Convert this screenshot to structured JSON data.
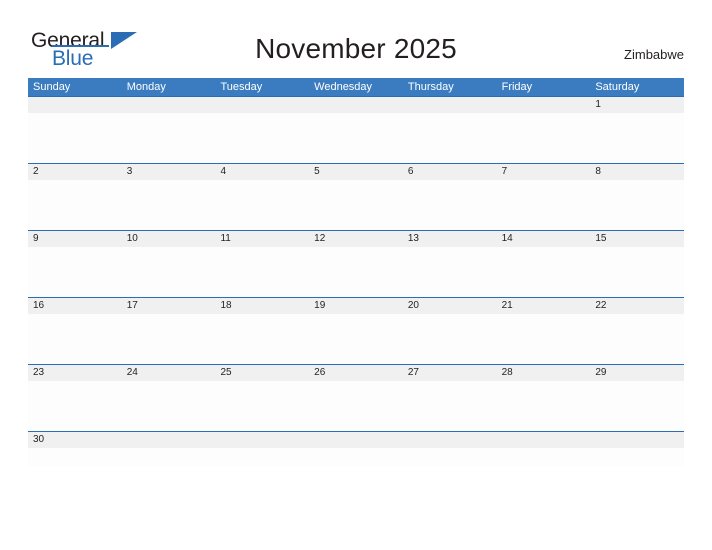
{
  "logo": {
    "primary_text": "General",
    "secondary_text": "Blue",
    "primary_color": "#231f20",
    "secondary_color": "#2a6db5"
  },
  "header": {
    "title": "November 2025",
    "country": "Zimbabwe"
  },
  "colors": {
    "header_bar": "#3b7cc0",
    "row_divider": "#2a6db5",
    "date_band": "#f0f0f0",
    "event_band": "#fdfdfd",
    "page_background": "#ffffff",
    "text": "#231f20",
    "header_text": "#ffffff"
  },
  "calendar": {
    "month": "November",
    "year": "2025",
    "weekday_headers": [
      "Sunday",
      "Monday",
      "Tuesday",
      "Wednesday",
      "Thursday",
      "Friday",
      "Saturday"
    ],
    "weeks": [
      {
        "days": [
          {
            "number": "",
            "events": []
          },
          {
            "number": "",
            "events": []
          },
          {
            "number": "",
            "events": []
          },
          {
            "number": "",
            "events": []
          },
          {
            "number": "",
            "events": []
          },
          {
            "number": "",
            "events": []
          },
          {
            "number": "1",
            "events": []
          }
        ]
      },
      {
        "days": [
          {
            "number": "2",
            "events": []
          },
          {
            "number": "3",
            "events": []
          },
          {
            "number": "4",
            "events": []
          },
          {
            "number": "5",
            "events": []
          },
          {
            "number": "6",
            "events": []
          },
          {
            "number": "7",
            "events": []
          },
          {
            "number": "8",
            "events": []
          }
        ]
      },
      {
        "days": [
          {
            "number": "9",
            "events": []
          },
          {
            "number": "10",
            "events": []
          },
          {
            "number": "11",
            "events": []
          },
          {
            "number": "12",
            "events": []
          },
          {
            "number": "13",
            "events": []
          },
          {
            "number": "14",
            "events": []
          },
          {
            "number": "15",
            "events": []
          }
        ]
      },
      {
        "days": [
          {
            "number": "16",
            "events": []
          },
          {
            "number": "17",
            "events": []
          },
          {
            "number": "18",
            "events": []
          },
          {
            "number": "19",
            "events": []
          },
          {
            "number": "20",
            "events": []
          },
          {
            "number": "21",
            "events": []
          },
          {
            "number": "22",
            "events": []
          }
        ]
      },
      {
        "days": [
          {
            "number": "23",
            "events": []
          },
          {
            "number": "24",
            "events": []
          },
          {
            "number": "25",
            "events": []
          },
          {
            "number": "26",
            "events": []
          },
          {
            "number": "27",
            "events": []
          },
          {
            "number": "28",
            "events": []
          },
          {
            "number": "29",
            "events": []
          }
        ]
      },
      {
        "days": [
          {
            "number": "30",
            "events": []
          },
          {
            "number": "",
            "events": []
          },
          {
            "number": "",
            "events": []
          },
          {
            "number": "",
            "events": []
          },
          {
            "number": "",
            "events": []
          },
          {
            "number": "",
            "events": []
          },
          {
            "number": "",
            "events": []
          }
        ]
      }
    ]
  }
}
